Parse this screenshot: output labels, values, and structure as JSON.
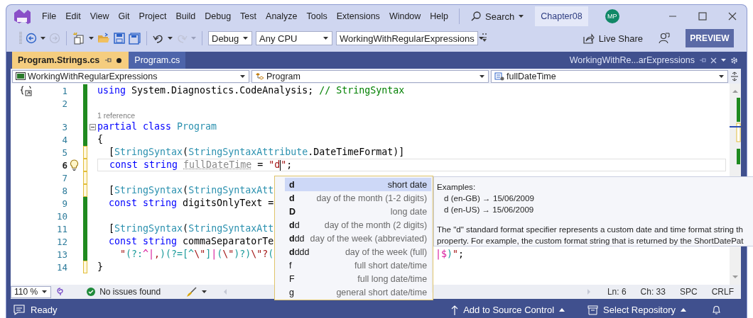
{
  "title_bar": {
    "menu": [
      "File",
      "Edit",
      "View",
      "Git",
      "Project",
      "Build",
      "Debug",
      "Test",
      "Analyze",
      "Tools",
      "Extensions",
      "Window",
      "Help"
    ],
    "search": "Search",
    "solution": "Chapter08",
    "avatar": "MP"
  },
  "toolbar": {
    "configuration": "Debug",
    "platform": "Any CPU",
    "startup_project": "WorkingWithRegularExpressions",
    "live_share": "Live Share",
    "preview": "PREVIEW"
  },
  "tabs": [
    {
      "label": "Program.Strings.cs",
      "selected": true,
      "pinned": true,
      "modified": true
    },
    {
      "label": "Program.cs",
      "selected": false,
      "pinned": false,
      "modified": false
    }
  ],
  "tool_tab": {
    "label": "WorkingWithRe...arExpressions"
  },
  "navigation": {
    "project": "WorkingWithRegularExpressions",
    "type": "Program",
    "member": "fullDateTime"
  },
  "editor": {
    "lines": [
      {
        "kind": "code",
        "number": "1",
        "saved": true,
        "current": false,
        "snippet_icon": true,
        "tokens": [
          {
            "kind": "keyword",
            "text": "using"
          },
          {
            "kind": "plain",
            "text": " System.Diagnostics.CodeAnalysis; "
          },
          {
            "kind": "comment",
            "text": "// StringSyntax"
          }
        ]
      },
      {
        "kind": "code",
        "number": "2",
        "saved": true,
        "current": false
      },
      {
        "kind": "lens",
        "text": "1 reference",
        "saved": true
      },
      {
        "kind": "code",
        "number": "3",
        "saved": true,
        "current": false,
        "fold": true,
        "tokens": [
          {
            "kind": "keyword",
            "text": "partial class "
          },
          {
            "kind": "type",
            "text": "Program"
          }
        ]
      },
      {
        "kind": "code",
        "number": "4",
        "saved": true,
        "current": false,
        "tokens": [
          {
            "kind": "plain",
            "text": "{"
          }
        ]
      },
      {
        "kind": "code",
        "number": "5",
        "saved": false,
        "current": false,
        "tokens": [
          {
            "kind": "plain",
            "text": "  ["
          },
          {
            "kind": "type",
            "text": "StringSyntax"
          },
          {
            "kind": "plain",
            "text": "("
          },
          {
            "kind": "type",
            "text": "StringSyntaxAttribute"
          },
          {
            "kind": "plain",
            "text": ".DateTimeFormat)]"
          }
        ]
      },
      {
        "kind": "code",
        "number": "6",
        "saved": false,
        "current": true,
        "lightbulb": true,
        "tokens": [
          {
            "kind": "keyword",
            "text": "  const string "
          },
          {
            "kind": "unused",
            "text": "fullDateTime"
          },
          {
            "kind": "plain",
            "text": " = "
          },
          {
            "kind": "string",
            "text": "\"d",
            "caret": true
          },
          {
            "kind": "string",
            "text": "\""
          },
          {
            "kind": "plain",
            "text": ";"
          }
        ]
      },
      {
        "kind": "code",
        "number": "7",
        "saved": false,
        "current": false
      },
      {
        "kind": "code",
        "number": "8",
        "saved": false,
        "current": false,
        "tokens": [
          {
            "kind": "plain",
            "text": "  ["
          },
          {
            "kind": "type",
            "text": "StringSyntax"
          },
          {
            "kind": "plain",
            "text": "("
          },
          {
            "kind": "type",
            "text": "StringSyntaxAtt"
          }
        ]
      },
      {
        "kind": "code",
        "number": "9",
        "saved": true,
        "current": false,
        "tokens": [
          {
            "kind": "keyword",
            "text": "  const string"
          },
          {
            "kind": "plain",
            "text": " digitsOnlyText ="
          }
        ]
      },
      {
        "kind": "code",
        "number": "10",
        "saved": true,
        "current": false
      },
      {
        "kind": "code",
        "number": "11",
        "saved": true,
        "current": false,
        "tokens": [
          {
            "kind": "plain",
            "text": "  ["
          },
          {
            "kind": "type",
            "text": "StringSyntax"
          },
          {
            "kind": "plain",
            "text": "("
          },
          {
            "kind": "type",
            "text": "StringSyntaxAtt"
          }
        ]
      },
      {
        "kind": "code",
        "number": "12",
        "saved": true,
        "current": false,
        "tokens": [
          {
            "kind": "keyword",
            "text": "  const string"
          },
          {
            "kind": "plain",
            "text": " commaSeparatorTe"
          }
        ]
      },
      {
        "kind": "code",
        "number": "13",
        "saved": true,
        "current": false,
        "tokens": [
          {
            "kind": "string",
            "text": "    \""
          },
          {
            "kind": "regex-group",
            "text": "(?:"
          },
          {
            "kind": "regex-anchor",
            "text": "^|"
          },
          {
            "kind": "string",
            "text": ","
          },
          {
            "kind": "regex-group",
            "text": ")(?=[^"
          },
          {
            "kind": "string",
            "text": "\\\""
          },
          {
            "kind": "regex-group",
            "text": "]"
          },
          {
            "kind": "regex-anchor",
            "text": "|"
          },
          {
            "kind": "regex-group",
            "text": "("
          },
          {
            "kind": "string",
            "text": "\\\""
          },
          {
            "kind": "regex-group",
            "text": ")?)"
          },
          {
            "kind": "string",
            "text": "\\\"?"
          },
          {
            "kind": "regex-group",
            "text": "("
          }
        ],
        "tail": [
          {
            "kind": "regex-anchor",
            "text": "|$"
          },
          {
            "kind": "regex-group",
            "text": ")"
          },
          {
            "kind": "string",
            "text": "\""
          },
          {
            "kind": "plain",
            "text": ";"
          }
        ]
      },
      {
        "kind": "code",
        "number": "14",
        "saved": false,
        "current": false,
        "tokens": [
          {
            "kind": "plain",
            "text": "}"
          }
        ]
      }
    ]
  },
  "completion": {
    "items": [
      {
        "key": "**d**",
        "description": "short date",
        "selected": true
      },
      {
        "key": "**d**",
        "description": "day of the month (1-2 digits)",
        "selected": false
      },
      {
        "key": "**D**",
        "description": "long date",
        "selected": false
      },
      {
        "key": "**d**d",
        "description": "day of the month (2 digits)",
        "selected": false
      },
      {
        "key": "**d**dd",
        "description": "day of the week (abbreviated)",
        "selected": false
      },
      {
        "key": "**d**ddd",
        "description": "day of the week (full)",
        "selected": false
      },
      {
        "key": "f",
        "description": "full short date/time",
        "selected": false
      },
      {
        "key": "F",
        "description": "full long date/time",
        "selected": false
      },
      {
        "key": "g",
        "description": "general short date/time",
        "selected": false
      }
    ]
  },
  "quick_info": {
    "heading": "Examples:",
    "examples": [
      "d (en-GB) → 15/06/2009",
      "d (en-US) → 15/06/2009"
    ],
    "description_lines": [
      "The \"d\" standard format specifier represents a custom date and time format string th",
      "property. For example, the custom format string that is returned by the ShortDatePat"
    ]
  },
  "editor_status": {
    "zoom": "110 %",
    "issues": "No issues found",
    "line": "Ln: 6",
    "column": "Ch: 33",
    "whitespace": "SPC",
    "line_ending": "CRLF"
  },
  "status_bar": {
    "message": "Ready",
    "source_control": "Add to Source Control",
    "repository": "Select Repository"
  }
}
